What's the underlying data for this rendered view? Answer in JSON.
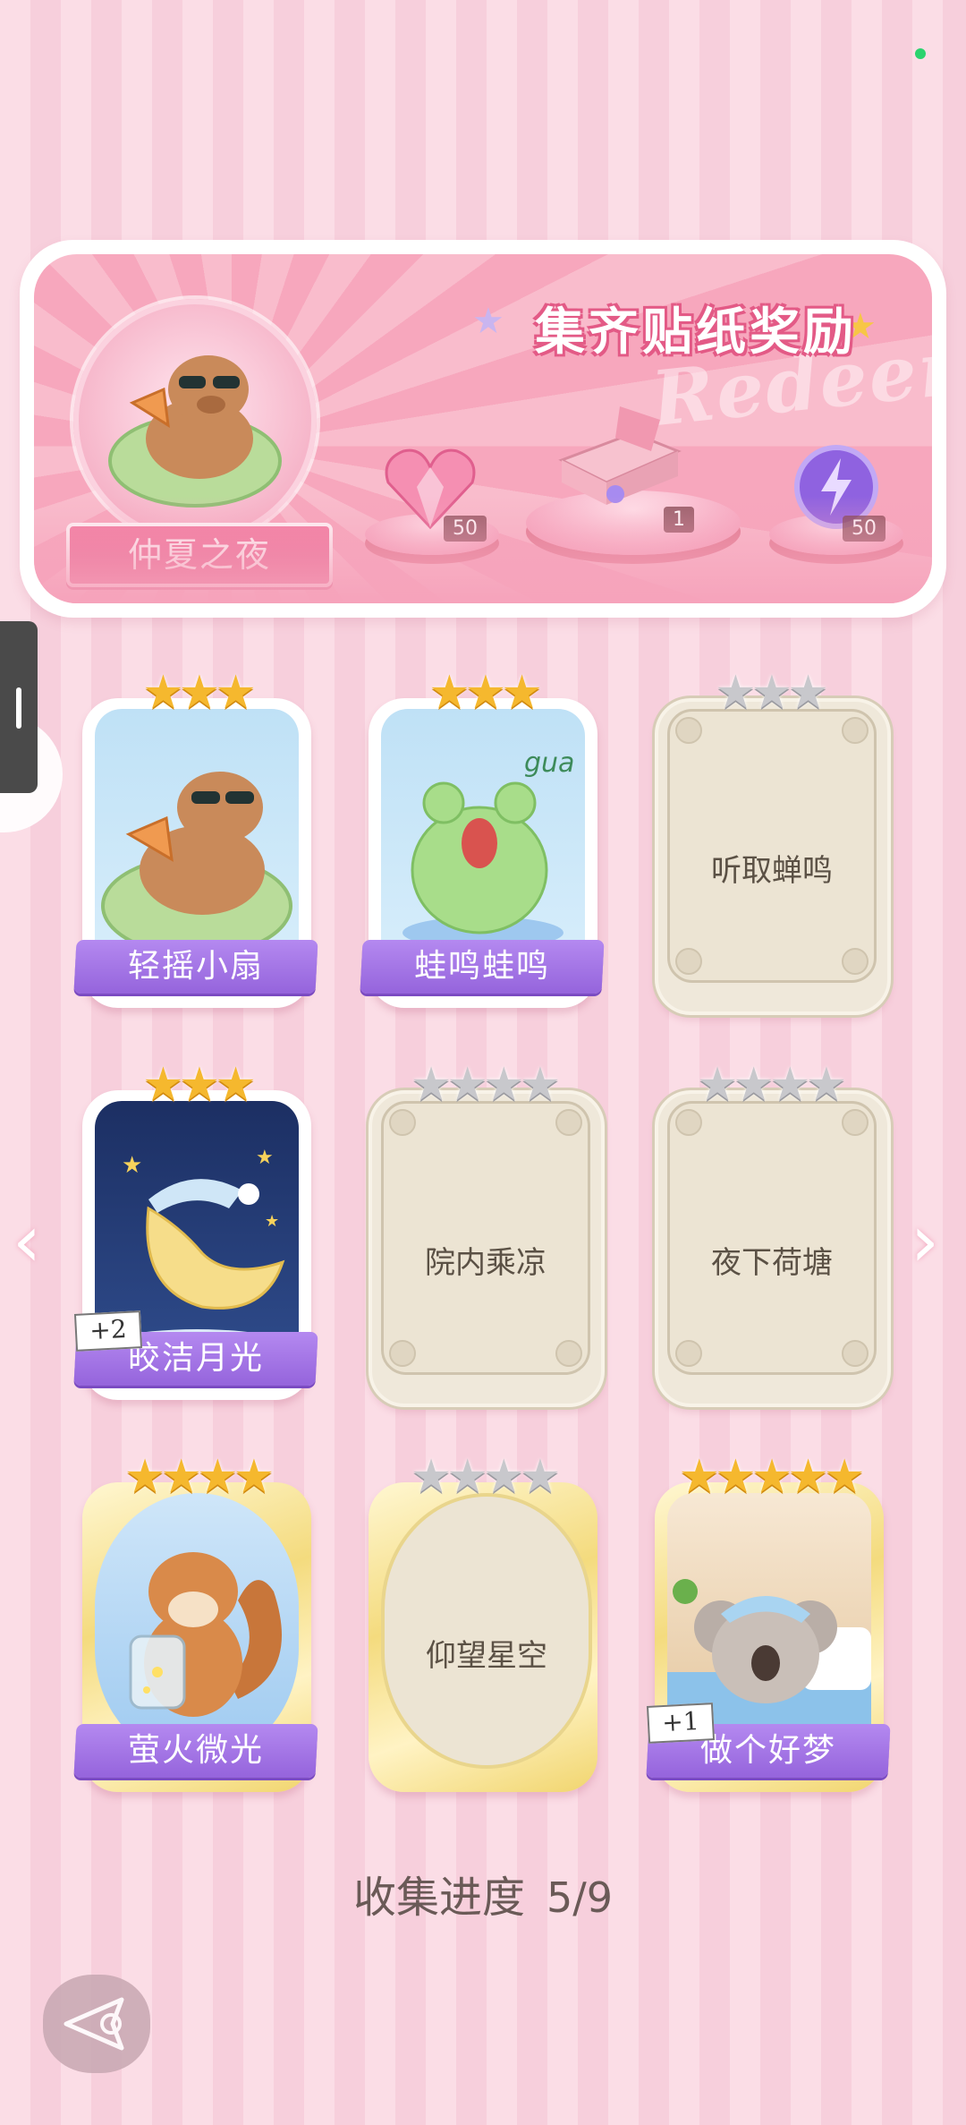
{
  "banner": {
    "title": "集齐贴纸奖励",
    "watermark": "Redeem",
    "collection_name": "仲夏之夜",
    "rewards": [
      {
        "icon": "pink-heart-gem-icon",
        "count": "50"
      },
      {
        "icon": "gift-box-icon",
        "count": "1"
      },
      {
        "icon": "purple-lightning-orb-icon",
        "count": "50"
      }
    ]
  },
  "cards": [
    {
      "name": "轻摇小扇",
      "stars": 3,
      "max_stars": 3,
      "unlocked": true
    },
    {
      "name": "蛙鸣蛙鸣",
      "stars": 3,
      "max_stars": 3,
      "unlocked": true
    },
    {
      "name": "听取蝉鸣",
      "stars": 0,
      "max_stars": 3,
      "unlocked": false
    },
    {
      "name": "皎洁月光",
      "stars": 3,
      "max_stars": 3,
      "unlocked": true,
      "extra": "+2"
    },
    {
      "name": "院内乘凉",
      "stars": 0,
      "max_stars": 4,
      "unlocked": false
    },
    {
      "name": "夜下荷塘",
      "stars": 0,
      "max_stars": 4,
      "unlocked": false
    },
    {
      "name": "萤火微光",
      "stars": 4,
      "max_stars": 4,
      "unlocked": true,
      "gold": true
    },
    {
      "name": "仰望星空",
      "stars": 0,
      "max_stars": 4,
      "unlocked": false,
      "gold": true
    },
    {
      "name": "做个好梦",
      "stars": 5,
      "max_stars": 5,
      "unlocked": true,
      "gold": true,
      "extra": "+1"
    }
  ],
  "progress": {
    "label": "收集进度",
    "value": "5/9"
  },
  "colors": {
    "accent_pink": "#e25584",
    "label_purple": "#9564dc",
    "star_gold": "#f5b82e"
  }
}
